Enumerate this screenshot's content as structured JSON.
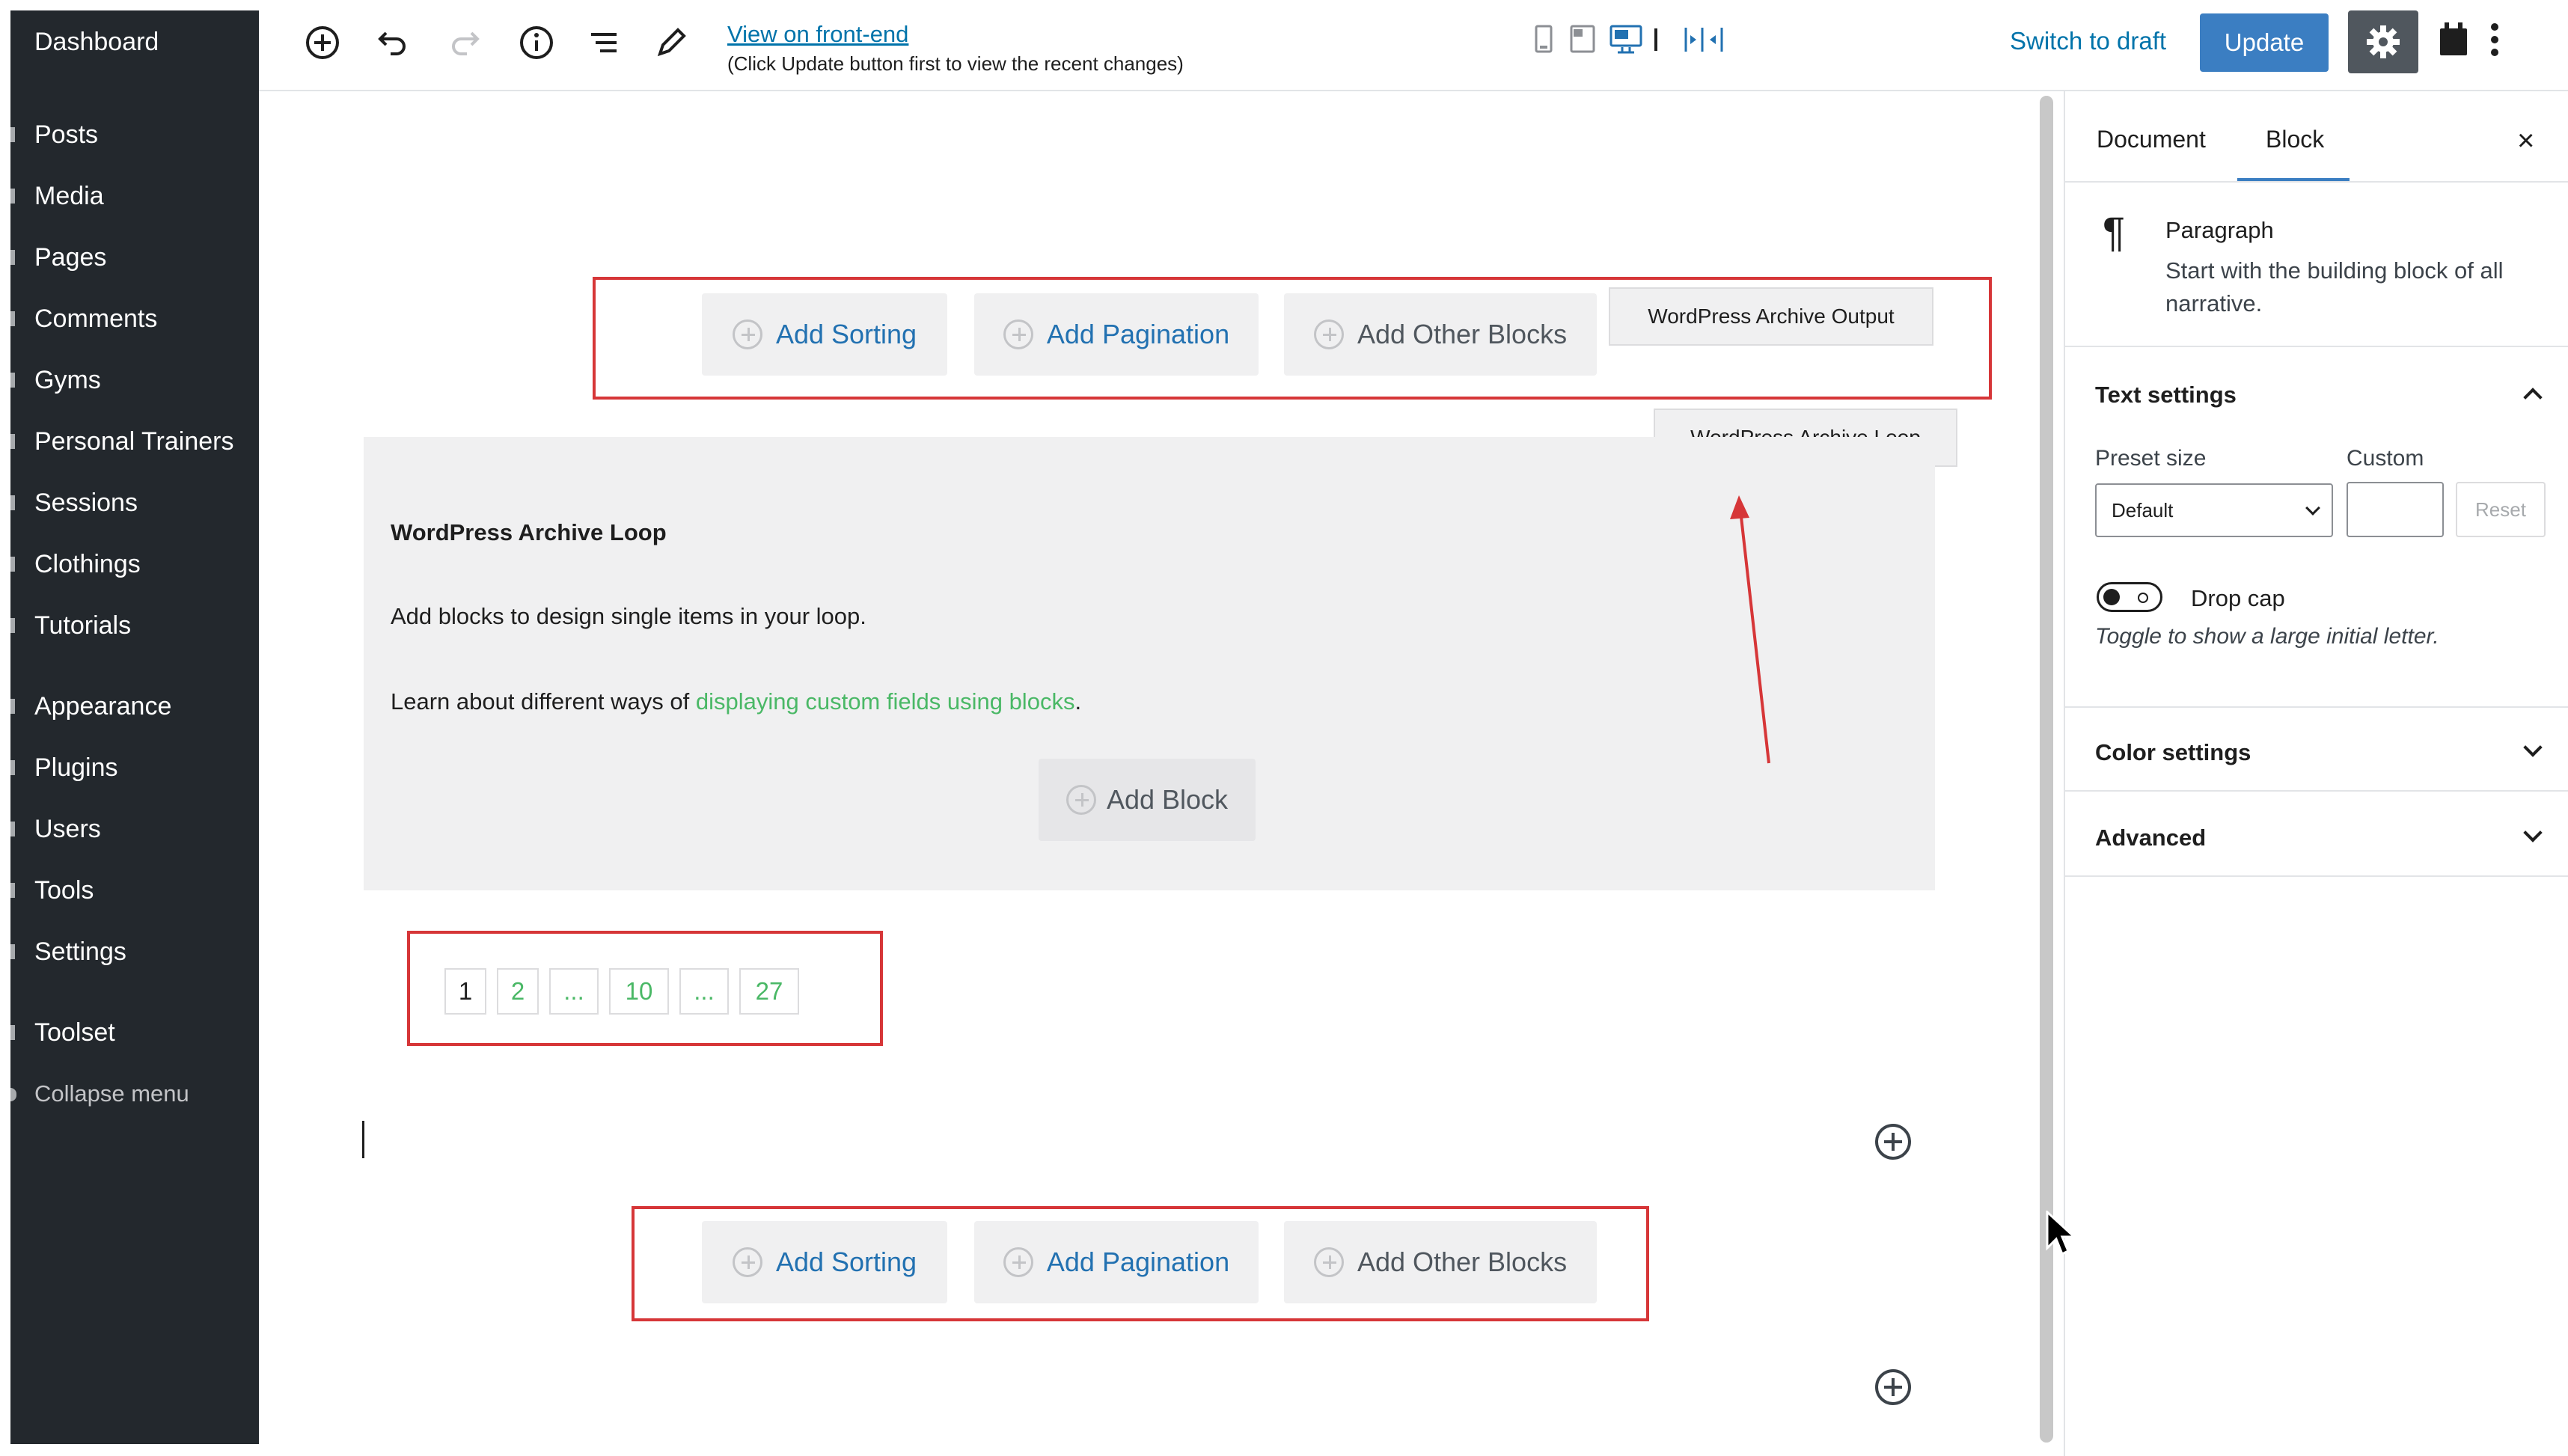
{
  "sidebar": {
    "items": [
      {
        "label": "Dashboard"
      },
      {
        "label": "Posts"
      },
      {
        "label": "Media"
      },
      {
        "label": "Pages"
      },
      {
        "label": "Comments"
      },
      {
        "label": "Gyms"
      },
      {
        "label": "Personal Trainers"
      },
      {
        "label": "Sessions"
      },
      {
        "label": "Clothings"
      },
      {
        "label": "Tutorials"
      },
      {
        "label": "Appearance"
      },
      {
        "label": "Plugins"
      },
      {
        "label": "Users"
      },
      {
        "label": "Tools"
      },
      {
        "label": "Settings"
      },
      {
        "label": "Toolset"
      }
    ],
    "collapse_label": "Collapse menu"
  },
  "toolbar": {
    "icons": [
      "add-block-icon",
      "undo-icon",
      "redo-icon",
      "info-icon",
      "list-view-icon",
      "edit-icon"
    ],
    "view_link": "View on front-end",
    "view_note": "(Click Update button first to view the recent changes)",
    "preview_icons": [
      "mobile-icon",
      "tablet-icon",
      "desktop-icon",
      "separator-icon",
      "width-toggle-icon"
    ],
    "switch_draft": "Switch to draft",
    "update": "Update",
    "settings_icon": "gear-icon",
    "plugin_icon": "plugin-icon",
    "more_icon": "more-vertical-icon"
  },
  "canvas": {
    "top_buttons": {
      "add_sorting": "Add Sorting",
      "add_pagination": "Add Pagination",
      "add_other_blocks": "Add Other Blocks"
    },
    "archive_output_label": "WordPress Archive Output",
    "archive_loop_label": "WordPress Archive Loop",
    "loop": {
      "title": "WordPress Archive Loop",
      "description": "Add blocks to design single items in your loop.",
      "learn_prefix": "Learn about different ways of ",
      "learn_link": "displaying custom fields using blocks",
      "learn_suffix": ".",
      "add_block": "Add Block"
    },
    "pagination": [
      "1",
      "2",
      "...",
      "10",
      "...",
      "27"
    ],
    "bottom_buttons": {
      "add_sorting": "Add Sorting",
      "add_pagination": "Add Pagination",
      "add_other_blocks": "Add Other Blocks"
    }
  },
  "panel": {
    "tabs": [
      "Document",
      "Block"
    ],
    "active_tab": "Block",
    "close": "×",
    "block_name": "Paragraph",
    "block_desc": "Start with the building block of all narrative.",
    "text_settings": "Text settings",
    "preset_size_label": "Preset size",
    "custom_label": "Custom",
    "preset_value": "Default",
    "reset": "Reset",
    "drop_cap": "Drop cap",
    "drop_cap_help": "Toggle to show a large initial letter.",
    "color_settings": "Color settings",
    "advanced": "Advanced"
  },
  "colors": {
    "accent": "#3b7ec2",
    "annotation_red": "#d63638",
    "link_green": "#4ab866",
    "sidebar_bg": "#23282d"
  }
}
